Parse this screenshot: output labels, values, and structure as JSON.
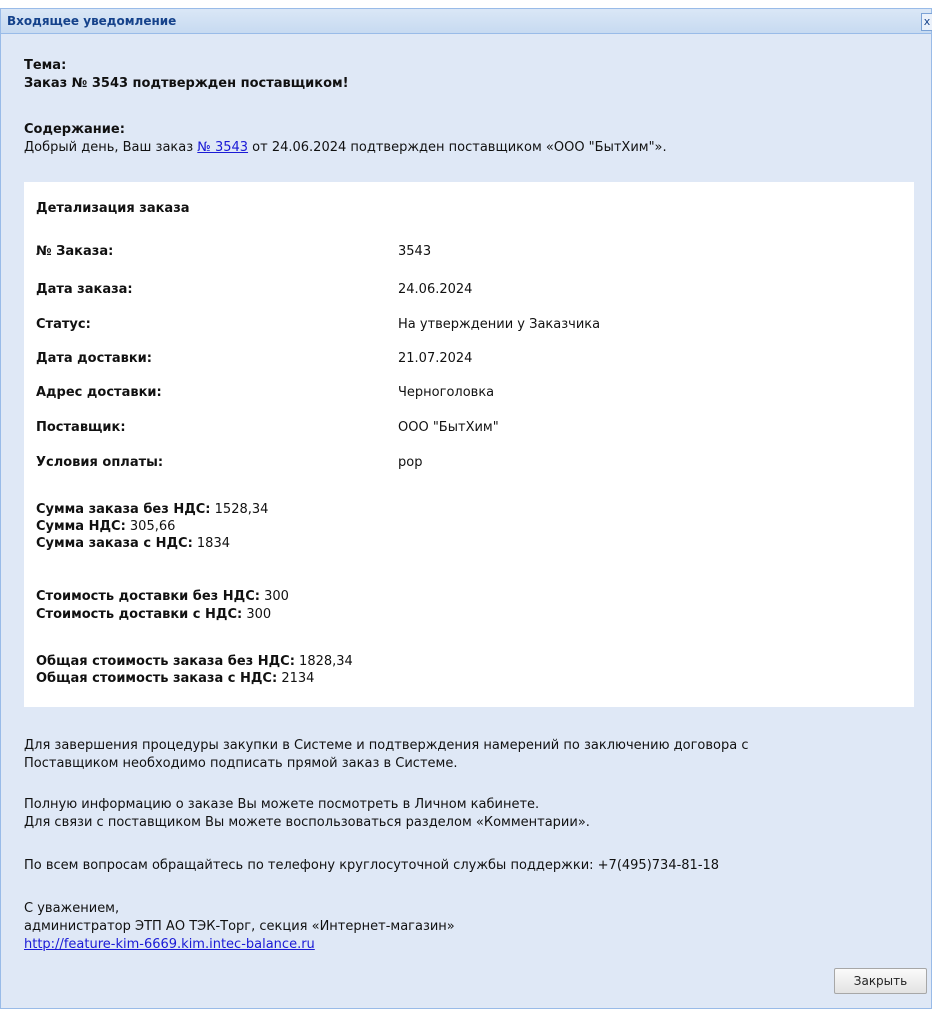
{
  "window": {
    "title": "Входящее уведомление",
    "close_glyph": "x"
  },
  "subject": {
    "label": "Тема:",
    "value": "Заказ № 3543 подтвержден поставщиком!"
  },
  "content": {
    "label": "Содержание:",
    "text_before": "Добрый день, Ваш заказ ",
    "link": "№ 3543",
    "text_after": " от 24.06.2024 подтвержден поставщиком «ООО \"БытХим\"»."
  },
  "details": {
    "title": "Детализация заказа",
    "rows": [
      {
        "label": "№ Заказа:",
        "value": "3543"
      },
      {
        "label": "Дата заказа:",
        "value": "24.06.2024"
      },
      {
        "label": "Статус:",
        "value": "На утверждении у Заказчика"
      },
      {
        "label": "Дата доставки:",
        "value": "21.07.2024"
      },
      {
        "label": "Адрес доставки:",
        "value": "Черноголовка"
      },
      {
        "label": "Поставщик:",
        "value": "ООО \"БытХим\""
      },
      {
        "label": "Условия оплаты:",
        "value": "pop"
      }
    ],
    "sums": [
      {
        "label": "Сумма заказа без НДС:",
        "value": " 1528,34"
      },
      {
        "label": "Сумма НДС:",
        "value": " 305,66"
      },
      {
        "label": "Сумма заказа с НДС:",
        "value": " 1834"
      },
      {
        "label": "Стоимость доставки без НДС:",
        "value": " 300"
      },
      {
        "label": "Стоимость доставки с НДС:",
        "value": " 300"
      },
      {
        "label": "Общая стоимость заказа без НДС:",
        "value": " 1828,34"
      },
      {
        "label": "Общая стоимость заказа с НДС:",
        "value": " 2134"
      }
    ]
  },
  "footer": {
    "p1_line1": "Для завершения процедуры закупки в Системе и подтверждения намерений по заключению договора с",
    "p1_line2": "Поставщиком необходимо подписать прямой заказ в Системе.",
    "p2_line1": "Полную информацию о заказе Вы можете посмотреть в Личном кабинете.",
    "p2_line2": "Для связи с поставщиком Вы можете воспользоваться разделом «Комментарии».",
    "p3": "По всем вопросам обращайтесь по телефону круглосуточной службы поддержки: +7(495)734-81-18",
    "sign1": "С уважением,",
    "sign2": "администратор ЭТП АО ТЭК-Торг, секция «Интернет-магазин»",
    "site_link": "http://feature-kim-6669.kim.intec-balance.ru"
  },
  "buttons": {
    "close_label": "Закрыть"
  },
  "colors": {
    "window_bg": "#dfe8f6",
    "title_text": "#15428b",
    "link": "#1a1ad6"
  }
}
